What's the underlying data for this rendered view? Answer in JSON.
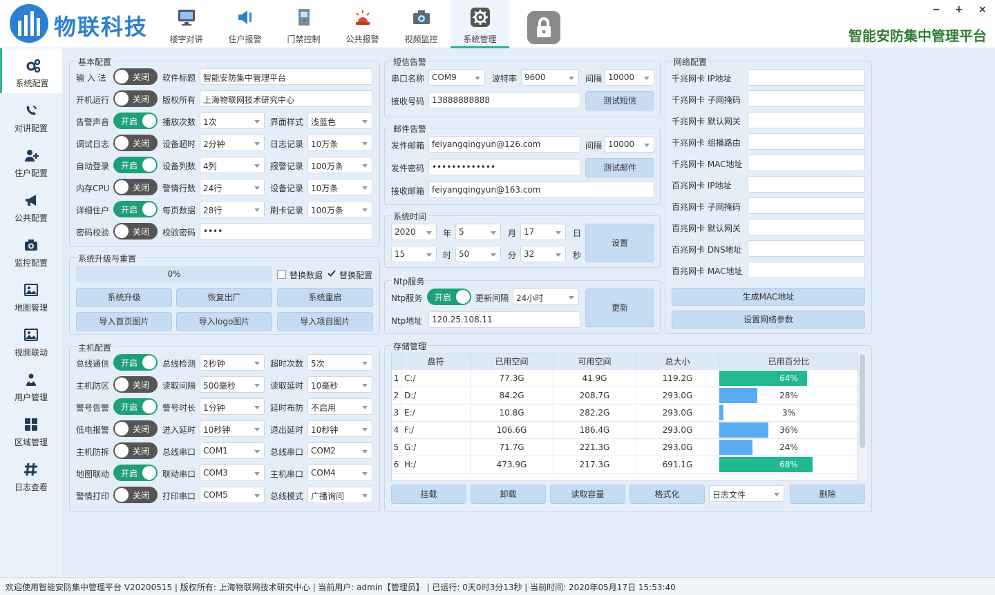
{
  "app": {
    "brand": "物联科技",
    "platform_title": "智能安防集中管理平台",
    "window_controls": {
      "minimize": "−",
      "maximize": "+",
      "close": "×"
    }
  },
  "colors": {
    "accent": "#1e9f7a",
    "brand_blue": "#2c7fd2",
    "bar_green": "#20b990",
    "bar_blue": "#5aabf2",
    "button": "#c6dcf2"
  },
  "nav": [
    {
      "label": "楼宇对讲",
      "icon": "monitor-icon"
    },
    {
      "label": "住户报警",
      "icon": "alarm-speaker-icon"
    },
    {
      "label": "门禁控制",
      "icon": "door-access-icon"
    },
    {
      "label": "公共报警",
      "icon": "siren-icon"
    },
    {
      "label": "视频监控",
      "icon": "camera-icon"
    },
    {
      "label": "系统管理",
      "icon": "gear-icon",
      "active": true
    }
  ],
  "sidebar": [
    {
      "label": "系统配置",
      "icon": "gears-icon",
      "active": true
    },
    {
      "label": "对讲配置",
      "icon": "phone-icon"
    },
    {
      "label": "住户配置",
      "icon": "user-add-icon"
    },
    {
      "label": "公共配置",
      "icon": "bullhorn-icon"
    },
    {
      "label": "监控配置",
      "icon": "camera-icon"
    },
    {
      "label": "地图管理",
      "icon": "image-icon"
    },
    {
      "label": "视频联动",
      "icon": "image-icon"
    },
    {
      "label": "用户管理",
      "icon": "users-icon"
    },
    {
      "label": "区域管理",
      "icon": "grid-icon"
    },
    {
      "label": "日志查看",
      "icon": "hash-icon"
    }
  ],
  "toggle": {
    "on": "开启",
    "off": "关闭"
  },
  "basic": {
    "title": "基本配置",
    "toggles": [
      {
        "label": "输 入 法",
        "on": false
      },
      {
        "label": "开机运行",
        "on": false
      },
      {
        "label": "告警声音",
        "on": true
      },
      {
        "label": "调试日志",
        "on": false
      },
      {
        "label": "自动登录",
        "on": true
      },
      {
        "label": "内存CPU",
        "on": false
      },
      {
        "label": "详细住户",
        "on": true
      },
      {
        "label": "密码校验",
        "on": false
      }
    ],
    "software_title": {
      "label": "软件标题",
      "value": "智能安防集中管理平台"
    },
    "copyright": {
      "label": "版权所有",
      "value": "上海物联网技术研究中心"
    },
    "mid": [
      {
        "label": "播放次数",
        "value": "1次"
      },
      {
        "label": "设备超时",
        "value": "2分钟"
      },
      {
        "label": "设备列数",
        "value": "4列"
      },
      {
        "label": "警情行数",
        "value": "24行"
      },
      {
        "label": "每页数据",
        "value": "28行"
      }
    ],
    "right": [
      {
        "label": "界面样式",
        "value": "浅蓝色"
      },
      {
        "label": "日志记录",
        "value": "10万条"
      },
      {
        "label": "报警记录",
        "value": "100万条"
      },
      {
        "label": "设备记录",
        "value": "10万条"
      },
      {
        "label": "刷卡记录",
        "value": "100万条"
      }
    ],
    "check_password": {
      "label": "校验密码",
      "value": "••••"
    }
  },
  "upgrade": {
    "title": "系统升级与重置",
    "progress_text": "0%",
    "progress": 0,
    "chk_replace_data": "替换数据",
    "chk_replace_config": "替换配置",
    "buttons": [
      "系统升级",
      "恢复出厂",
      "系统重启",
      "导入首页图片",
      "导入logo图片",
      "导入项目图片"
    ]
  },
  "host": {
    "title": "主机配置",
    "toggles": [
      {
        "label": "总线通信",
        "on": true
      },
      {
        "label": "主机防区",
        "on": false
      },
      {
        "label": "警号告警",
        "on": true
      },
      {
        "label": "低电报警",
        "on": false
      },
      {
        "label": "主机防拆",
        "on": false
      },
      {
        "label": "地图联动",
        "on": true
      },
      {
        "label": "警情打印",
        "on": false
      }
    ],
    "mid": [
      {
        "label": "总线检测",
        "value": "2秒钟"
      },
      {
        "label": "读取间隔",
        "value": "500毫秒"
      },
      {
        "label": "警号时长",
        "value": "1分钟"
      },
      {
        "label": "进入延时",
        "value": "10秒钟"
      },
      {
        "label": "总线串口",
        "value": "COM1"
      },
      {
        "label": "联动串口",
        "value": "COM3"
      },
      {
        "label": "打印串口",
        "value": "COM5"
      }
    ],
    "right": [
      {
        "label": "超时次数",
        "value": "5次"
      },
      {
        "label": "读取延时",
        "value": "10毫秒"
      },
      {
        "label": "延时布防",
        "value": "不启用"
      },
      {
        "label": "退出延时",
        "value": "10秒钟"
      },
      {
        "label": "总线串口",
        "value": "COM2"
      },
      {
        "label": "主机串口",
        "value": "COM4"
      },
      {
        "label": "总线模式",
        "value": "广播询问"
      }
    ]
  },
  "sms": {
    "title": "短信告警",
    "port_label": "串口名称",
    "port": "COM9",
    "baud_label": "波特率",
    "baud": "9600",
    "interval_label": "间隔",
    "interval": "10000",
    "recv_label": "接收号码",
    "recv": "13888888888",
    "test": "测试短信"
  },
  "mail": {
    "title": "邮件告警",
    "from_label": "发件邮箱",
    "from": "feiyangqingyun@126.com",
    "interval_label": "间隔",
    "interval": "10000",
    "pwd_label": "发件密码",
    "pwd": "•••••••••••••",
    "test": "测试邮件",
    "to_label": "接收邮箱",
    "to": "feiyangqingyun@163.com"
  },
  "systime": {
    "title": "系统时间",
    "year": "2020",
    "year_unit": "年",
    "month": "5",
    "month_unit": "月",
    "day": "17",
    "day_unit": "日",
    "hour": "15",
    "hour_unit": "时",
    "minute": "50",
    "minute_unit": "分",
    "second": "32",
    "second_unit": "秒",
    "set": "设置"
  },
  "ntp": {
    "title": "Ntp服务",
    "service_label": "Ntp服务",
    "on": true,
    "interval_label": "更新间隔",
    "interval": "24小时",
    "addr_label": "Ntp地址",
    "addr": "120.25.108.11",
    "update": "更新"
  },
  "network": {
    "title": "网络配置",
    "fields": [
      "千兆网卡 IP地址",
      "千兆网卡 子网掩码",
      "千兆网卡 默认网关",
      "千兆网卡 组播路由",
      "千兆网卡 MAC地址",
      "百兆网卡 IP地址",
      "百兆网卡 子网掩码",
      "百兆网卡 默认网关",
      "百兆网卡 DNS地址",
      "百兆网卡 MAC地址"
    ],
    "gen_mac": "生成MAC地址",
    "apply": "设置网络参数"
  },
  "storage": {
    "title": "存储管理",
    "headers": [
      "盘符",
      "已用空间",
      "可用空间",
      "总大小",
      "已用百分比"
    ],
    "rows": [
      {
        "n": "1",
        "drive": "C:/",
        "used": "77.3G",
        "free": "41.9G",
        "total": "119.2G",
        "pct": 64,
        "pct_text": "64%",
        "color": "green"
      },
      {
        "n": "2",
        "drive": "D:/",
        "used": "84.2G",
        "free": "208.7G",
        "total": "293.0G",
        "pct": 28,
        "pct_text": "28%",
        "color": "blue"
      },
      {
        "n": "3",
        "drive": "E:/",
        "used": "10.8G",
        "free": "282.2G",
        "total": "293.0G",
        "pct": 3,
        "pct_text": "3%",
        "color": "blue"
      },
      {
        "n": "4",
        "drive": "F:/",
        "used": "106.6G",
        "free": "186.4G",
        "total": "293.0G",
        "pct": 36,
        "pct_text": "36%",
        "color": "blue"
      },
      {
        "n": "5",
        "drive": "G:/",
        "used": "71.7G",
        "free": "221.3G",
        "total": "293.0G",
        "pct": 24,
        "pct_text": "24%",
        "color": "blue"
      },
      {
        "n": "6",
        "drive": "H:/",
        "used": "473.9G",
        "free": "217.3G",
        "total": "691.1G",
        "pct": 68,
        "pct_text": "68%",
        "color": "green"
      }
    ],
    "buttons": [
      "挂载",
      "卸载",
      "读取容量",
      "格式化"
    ],
    "log_select": "日志文件",
    "delete": "删除"
  },
  "status": "欢迎使用智能安防集中管理平台 V20200515 | 版权所有: 上海物联网技术研究中心 | 当前用户: admin【管理员】 | 已运行: 0天0时3分13秒 | 当前时间: 2020年05月17日 15:53:40"
}
